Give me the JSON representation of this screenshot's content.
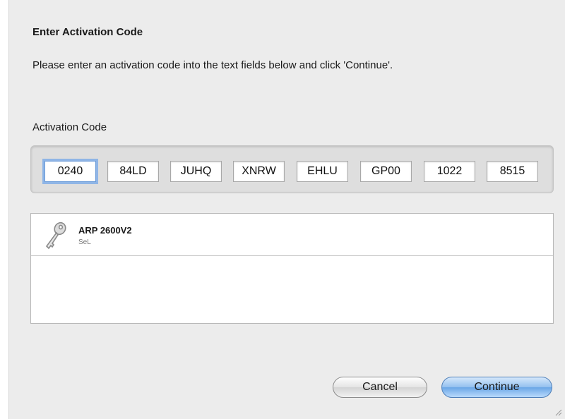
{
  "dialog": {
    "title": "Enter Activation Code",
    "instructions": "Please enter an activation code into the text fields below and click 'Continue'.",
    "code_label": "Activation Code",
    "code_fields": [
      "0240",
      "84LD",
      "JUHQ",
      "XNRW",
      "EHLU",
      "GP00",
      "1022",
      "8515"
    ]
  },
  "product": {
    "icon": "key-icon",
    "name": "ARP 2600V2",
    "subtitle": "SeL"
  },
  "buttons": {
    "cancel_label": "Cancel",
    "continue_label": "Continue"
  },
  "colors": {
    "dialog_background": "#ececec",
    "focus_ring": "#8fb5e6",
    "primary_button": "#6aa6e6"
  }
}
